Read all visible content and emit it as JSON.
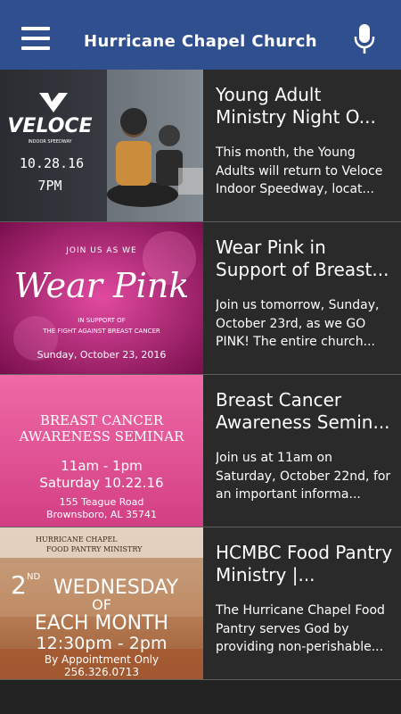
{
  "app": {
    "title": "Hurricane Chapel Church"
  },
  "icons": {
    "menu": "hamburger-menu-icon",
    "mic": "microphone-icon"
  },
  "colors": {
    "appbar": "#2f4f8f",
    "background": "#262626",
    "text": "#ffffff"
  },
  "posts": [
    {
      "title": "Young Adult Ministry Night O...",
      "excerpt": "This month, the Young Adults will return to Veloce Indoor Speedway, locat...",
      "thumb": {
        "brand": "VELOCE",
        "subbrand": "INDOOR SPEEDWAY",
        "date": "10.28.16",
        "time": "7PM"
      }
    },
    {
      "title": "Wear Pink in Support of Breast...",
      "excerpt": "Join us tomorrow, Sunday, October 23rd, as we GO PINK! The entire church...",
      "thumb": {
        "top": "JOIN US AS WE",
        "headline": "Wear Pink",
        "sub1": "IN SUPPORT OF",
        "sub2": "THE FIGHT AGAINST BREAST CANCER",
        "date": "Sunday, October 23, 2016"
      }
    },
    {
      "title": "Breast Cancer Awareness Semin...",
      "excerpt": "Join us at 11am on Saturday, October 22nd, for an important informa...",
      "thumb": {
        "line1": "BREAST CANCER",
        "line2": "AWARENESS SEMINAR",
        "time": "11am - 1pm",
        "date": "Saturday 10.22.16",
        "addr1": "155 Teague Road",
        "addr2": "Brownsboro, AL 35741"
      }
    },
    {
      "title": "HCMBC Food Pantry Ministry |...",
      "excerpt": "The Hurricane Chapel Food Pantry serves God by providing non-perishable...",
      "thumb": {
        "org1": "HURRICANE CHAPEL",
        "org2": "FOOD PANTRY MINISTRY",
        "ord": "ND",
        "num": "2",
        "day": "WEDNESDAY",
        "of": "OF",
        "each": "EACH MONTH",
        "time": "12:30pm - 2pm",
        "appt": "By Appointment Only",
        "phone": "256.326.0713"
      }
    }
  ]
}
